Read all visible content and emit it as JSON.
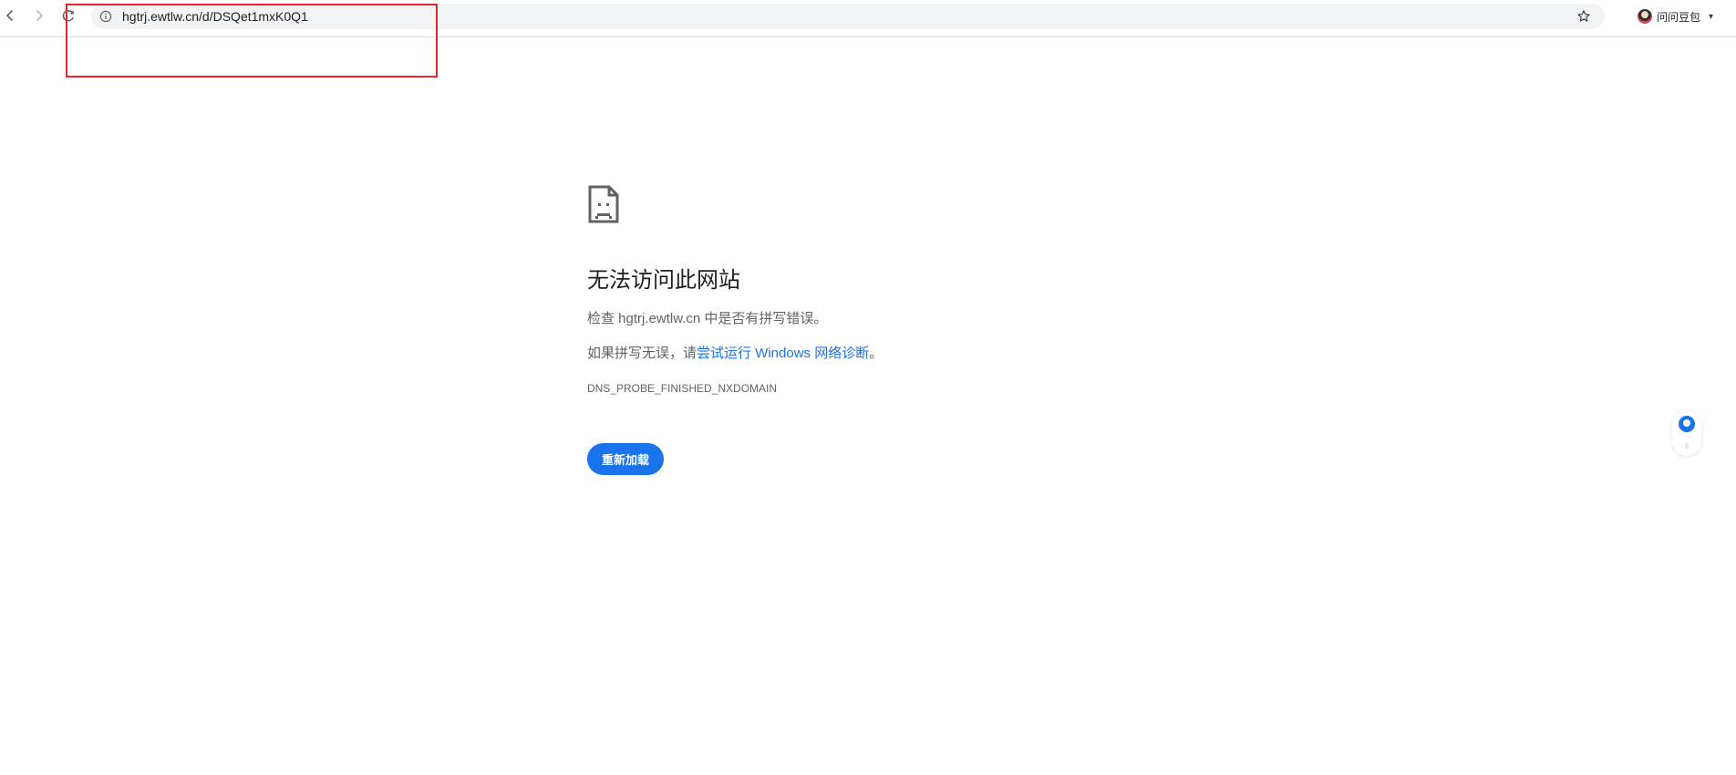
{
  "browser": {
    "address_bar": {
      "url": "hgtrj.ewtlw.cn/d/DSQet1mxK0Q1"
    },
    "profile": {
      "name": "问问豆包"
    }
  },
  "error_page": {
    "title": "无法访问此网站",
    "check_text": "检查 hgtrj.ewtlw.cn 中是否有拼写错误。",
    "suggestion_prefix": "如果拼写无误，请",
    "diagnostic_link": "尝试运行 Windows 网络诊断",
    "suggestion_suffix": "。",
    "error_code": "DNS_PROBE_FINISHED_NXDOMAIN",
    "reload_label": "重新加载"
  },
  "colors": {
    "accent": "#1a73e8",
    "annotation_red": "#e3262b",
    "secondary_text": "#5f6368"
  },
  "icons": {
    "back": "back-arrow-icon",
    "forward": "forward-arrow-icon",
    "reload": "reload-icon",
    "site_info": "info-icon",
    "bookmark": "star-icon",
    "error": "sad-page-icon",
    "assistant": "assistant-bubble-icon"
  }
}
